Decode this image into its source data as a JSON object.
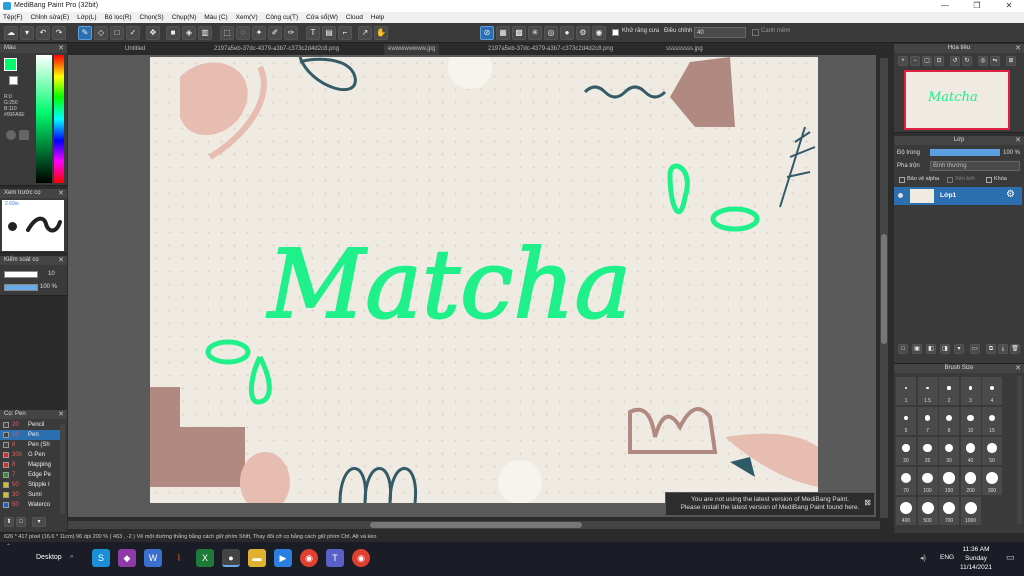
{
  "window": {
    "title": "MediBang Paint Pro (32bit)",
    "minimize": "—",
    "maximize": "❐",
    "close": "✕"
  },
  "menu": [
    "Tệp(F)",
    "Chỉnh sửa(E)",
    "Lớp(L)",
    "Bộ lọc(R)",
    "Chọn(S)",
    "Chụp(N)",
    "Màu (C)",
    "Xem(V)",
    "Công cụ(T)",
    "Cửa sổ(W)",
    "Cloud",
    "Help"
  ],
  "toolbar": {
    "antialias_label": "Khử răng cưa",
    "adjust_label": "Điều chỉnh",
    "adjust_value": "40",
    "snap_label": "Canh mềm"
  },
  "tabs": [
    "Untitled",
    "2197a5eb-37dc-4379-a3b7-c373c2d4d2c8.png",
    "ewwwwwwww.jpg",
    "2197a5eb-37dc-4379-a3b7-c373c2d4d2c8.png",
    "sssssssss.jpg"
  ],
  "color_panel": {
    "title": "Màu",
    "r": "R:0",
    "g": "G:250",
    "b": "B:110",
    "hex": "#00FA6E",
    "fg_color": "#00fa6e"
  },
  "brush_preview": {
    "title": "Xem trước cọ",
    "size": "2.69in"
  },
  "brush_control": {
    "title": "Kiểm soát cọ",
    "size": "10",
    "opacity": "100 %"
  },
  "brush_list": {
    "title": "Cọ: Pen",
    "items": [
      {
        "size": "20",
        "name": "Pencil",
        "color": "#444"
      },
      {
        "size": "10",
        "name": "Pen",
        "color": "#444"
      },
      {
        "size": "8",
        "name": "Pen (Sh",
        "color": "#444"
      },
      {
        "size": "300",
        "name": "G Pen",
        "color": "#d03030"
      },
      {
        "size": "8",
        "name": "Mapping",
        "color": "#d03030"
      },
      {
        "size": "7",
        "name": "Edge Pe",
        "color": "#3a8a3a"
      },
      {
        "size": "50",
        "name": "Stipple I",
        "color": "#d0c020"
      },
      {
        "size": "30",
        "name": "Sumi",
        "color": "#d0c020"
      },
      {
        "size": "50",
        "name": "Waterco",
        "color": "#2060c0"
      }
    ]
  },
  "navigator": {
    "title": "Hoa tiêu"
  },
  "layers": {
    "title": "Lớp",
    "opacity_label": "Độ trong",
    "opacity_value": "100 %",
    "blend_label": "Pha trộn",
    "blend_value": "Bình thường",
    "alpha_label": "Bảo vệ alpha",
    "clip_label": "Xén bớt",
    "lock_label": "Khóa",
    "layer_name": "Lớp1"
  },
  "brush_size": {
    "title": "Brush Size",
    "sizes": [
      "1",
      "1.5",
      "2",
      "3",
      "4",
      "5",
      "7",
      "8",
      "10",
      "15",
      "20",
      "25",
      "30",
      "40",
      "50",
      "70",
      "100",
      "150",
      "200",
      "300",
      "400",
      "500",
      "700",
      "1000"
    ]
  },
  "canvas": {
    "lettering": "Matcha"
  },
  "notice": {
    "line1": "You are not using the latest version of MediBang Paint.",
    "line2": "Please install the latest version of MediBang Paint found here."
  },
  "status": {
    "text": "626 * 417 pixel   (16.6 * 11cm)   96 dpi   200 %   ( 463 , -2 )   Vẽ một đường thẳng bằng cách giữ phím Shift, Thay đổi cỡ cọ bằng cách giữ phím Ctrl, Alt và kéo"
  },
  "taskbar": {
    "desktop": "Desktop",
    "lang": "ENG",
    "time": "11:36 AM",
    "day": "Sunday",
    "date": "11/14/2021"
  }
}
